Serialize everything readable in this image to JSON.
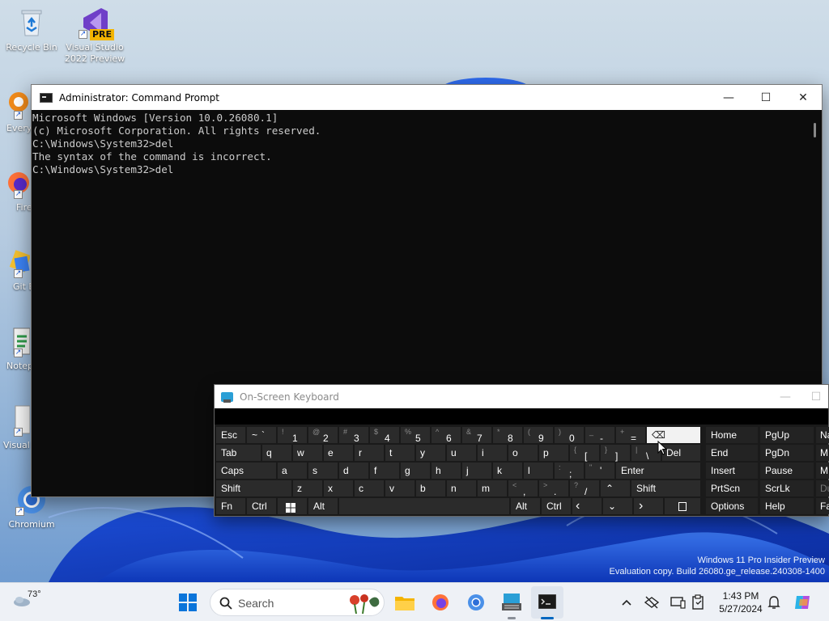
{
  "desktop": {
    "icons": [
      {
        "label": "Recycle Bin"
      },
      {
        "label": "Visual Studio 2022 Preview",
        "badge": "PRE"
      },
      {
        "label": "Every"
      },
      {
        "label": "Fire"
      },
      {
        "label": "Git B"
      },
      {
        "label": "Notep"
      },
      {
        "label": "Visual Co"
      },
      {
        "label": "Chromium"
      }
    ],
    "watermark": {
      "line1": "Windows 11 Pro Insider Preview",
      "line2": "Evaluation copy. Build 26080.ge_release.240308-1400"
    }
  },
  "cmd_window": {
    "title": "Administrator: Command Prompt",
    "controls": {
      "minimize": "—",
      "maximize": "☐",
      "close": "✕"
    },
    "lines": [
      "Microsoft Windows [Version 10.0.26080.1]",
      "(c) Microsoft Corporation. All rights reserved.",
      "",
      "C:\\Windows\\System32>del",
      "The syntax of the command is incorrect.",
      "",
      "C:\\Windows\\System32>del"
    ]
  },
  "osk": {
    "title": "On-Screen Keyboard",
    "controls": {
      "minimize": "—",
      "maximize": "☐"
    },
    "keys": {
      "esc": "Esc",
      "tilde": "~",
      "backtick": "`",
      "n1": "1",
      "s1": "!",
      "n2": "2",
      "s2": "@",
      "n3": "3",
      "s3": "#",
      "n4": "4",
      "s4": "$",
      "n5": "5",
      "s5": "%",
      "n6": "6",
      "s6": "^",
      "n7": "7",
      "s7": "&",
      "n8": "8",
      "s8": "*",
      "n9": "9",
      "s9": "(",
      "n0": "0",
      "s0": ")",
      "minus": "-",
      "underscore": "_",
      "equals": "=",
      "plus": "+",
      "backspace": "⌫",
      "home": "Home",
      "pgup": "PgUp",
      "nav_r1": "Na",
      "tab": "Tab",
      "q": "q",
      "w": "w",
      "e": "e",
      "r": "r",
      "t": "t",
      "y": "y",
      "u": "u",
      "i": "i",
      "o": "o",
      "p": "p",
      "lbracket": "[",
      "lbrace": "{",
      "rbracket": "]",
      "rbrace": "}",
      "backslash": "\\",
      "pipe": "|",
      "del": "Del",
      "end": "End",
      "pgdn": "PgDn",
      "nav_r2": "M",
      "caps": "Caps",
      "a": "a",
      "s": "s",
      "d": "d",
      "f": "f",
      "g": "g",
      "h": "h",
      "j": "j",
      "k": "k",
      "l": "l",
      "semicolon": ";",
      "colon": ":",
      "quote": "'",
      "dquote": "\"",
      "enter": "Enter",
      "insert": "Insert",
      "pause": "Pause",
      "nav_r3": "M",
      "shift": "Shift",
      "z": "z",
      "x": "x",
      "c": "c",
      "v": "v",
      "b": "b",
      "n": "n",
      "m": "m",
      "comma": ",",
      "lt": "<",
      "period": ".",
      "gt": ">",
      "slash": "/",
      "question": "?",
      "up": "⌃",
      "rshift": "Shift",
      "prtscn": "PrtScn",
      "scrlk": "ScrLk",
      "nav_r4": "Du",
      "fn": "Fn",
      "ctrl": "Ctrl",
      "alt": "Alt",
      "ralt": "Alt",
      "rctrl": "Ctrl",
      "left": "‹",
      "down": "⌄",
      "right": "›",
      "options": "Options",
      "help": "Help",
      "nav_r5": "Fa"
    }
  },
  "taskbar": {
    "weather_temp": "73°",
    "search_placeholder": "Search",
    "clock_time": "1:43 PM",
    "clock_date": "5/27/2024"
  },
  "colors": {
    "accent": "#0067c0",
    "console_bg": "#0c0c0c",
    "console_fg": "#cccccc",
    "osk_key": "#2b2b2b"
  }
}
